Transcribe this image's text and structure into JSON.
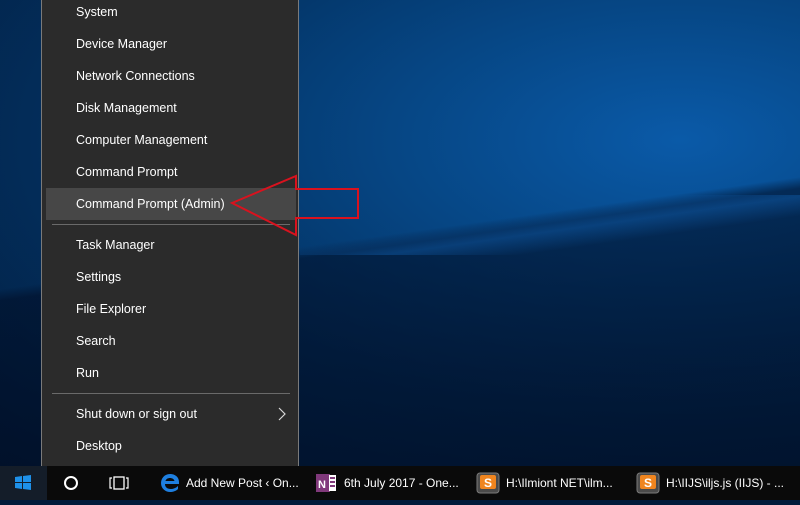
{
  "context_menu": {
    "groups": [
      [
        {
          "label": "System"
        },
        {
          "label": "Device Manager"
        },
        {
          "label": "Network Connections"
        },
        {
          "label": "Disk Management"
        },
        {
          "label": "Computer Management"
        },
        {
          "label": "Command Prompt"
        },
        {
          "label": "Command Prompt (Admin)",
          "highlighted": true
        }
      ],
      [
        {
          "label": "Task Manager"
        },
        {
          "label": "Settings"
        },
        {
          "label": "File Explorer"
        },
        {
          "label": "Search"
        },
        {
          "label": "Run"
        }
      ],
      [
        {
          "label": "Shut down or sign out",
          "has_submenu": true
        },
        {
          "label": "Desktop"
        }
      ]
    ]
  },
  "annotation": {
    "type": "arrow-outline",
    "color": "#d9121e",
    "points_to": "Command Prompt (Admin)"
  },
  "taskbar": {
    "start_icon": "windows-logo-icon",
    "search_icon": "cortana-circle-icon",
    "task_view_icon": "task-view-icon",
    "apps": [
      {
        "icon": "edge-icon",
        "label": "Add New Post ‹ On..."
      },
      {
        "icon": "onenote-icon",
        "label": "6th July 2017 - One..."
      },
      {
        "icon": "sublime-text-icon",
        "label": "H:\\Ilmiont NET\\ilm..."
      },
      {
        "icon": "sublime-text-icon",
        "label": "H:\\IIJS\\iljs.js (IIJS) - ..."
      }
    ]
  },
  "colors": {
    "menu_bg": "#2b2b2b",
    "menu_hover": "#474747",
    "windows_blue": "#1e90e8",
    "onenote_purple": "#80397b",
    "sublime_orange": "#f0851f"
  }
}
